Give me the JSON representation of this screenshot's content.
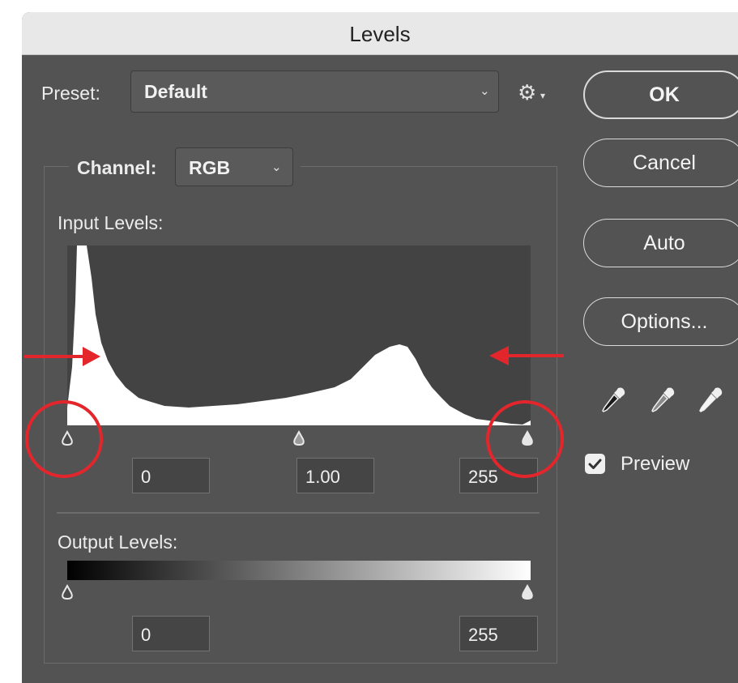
{
  "dialog": {
    "title": "Levels"
  },
  "preset": {
    "label": "Preset:",
    "value": "Default"
  },
  "channel": {
    "label": "Channel:",
    "value": "RGB"
  },
  "input_levels": {
    "label": "Input Levels:",
    "shadow": "0",
    "midtone": "1.00",
    "highlight": "255"
  },
  "output_levels": {
    "label": "Output Levels:",
    "black": "0",
    "white": "255"
  },
  "buttons": {
    "ok": "OK",
    "cancel": "Cancel",
    "auto": "Auto",
    "options": "Options..."
  },
  "preview": {
    "label": "Preview",
    "checked": true
  },
  "icons": {
    "gear": "gear-icon",
    "dropdown": "chevron-down-icon",
    "black_point": "eyedropper-black-icon",
    "gray_point": "eyedropper-gray-icon",
    "white_point": "eyedropper-white-icon",
    "check": "checkmark-icon"
  },
  "colors": {
    "dialog_bg": "#535353",
    "histogram_bg": "#434343",
    "histogram_fill": "#ffffff",
    "annotation": "#e3262b",
    "button_border": "#dadada"
  }
}
